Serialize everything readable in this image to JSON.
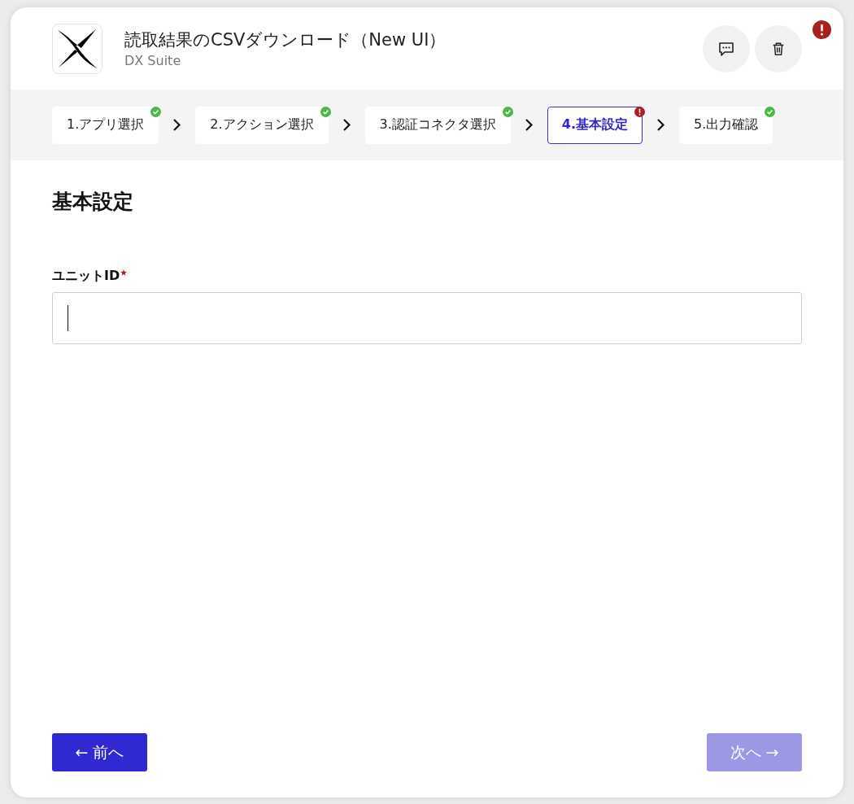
{
  "app": {
    "title": "読取結果のCSVダウンロード（New UI）",
    "subtitle": "DX Suite",
    "has_error": true
  },
  "steps": [
    {
      "label": "1.アプリ選択",
      "selected": false,
      "has_error": false
    },
    {
      "label": "2.アクション選択",
      "selected": false,
      "has_error": false
    },
    {
      "label": "3.認証コネクタ選択",
      "selected": false,
      "has_error": false
    },
    {
      "label": "4.基本設定",
      "selected": true,
      "has_error": true
    },
    {
      "label": "5.出力確認",
      "selected": false,
      "has_error": false
    }
  ],
  "section_title": "基本設定",
  "field": {
    "label": "ユニットID",
    "required": true,
    "focused": true
  },
  "buttons": [
    {
      "label": "← 前へ",
      "disabled": false
    },
    {
      "label": "次へ →",
      "disabled": true
    }
  ]
}
